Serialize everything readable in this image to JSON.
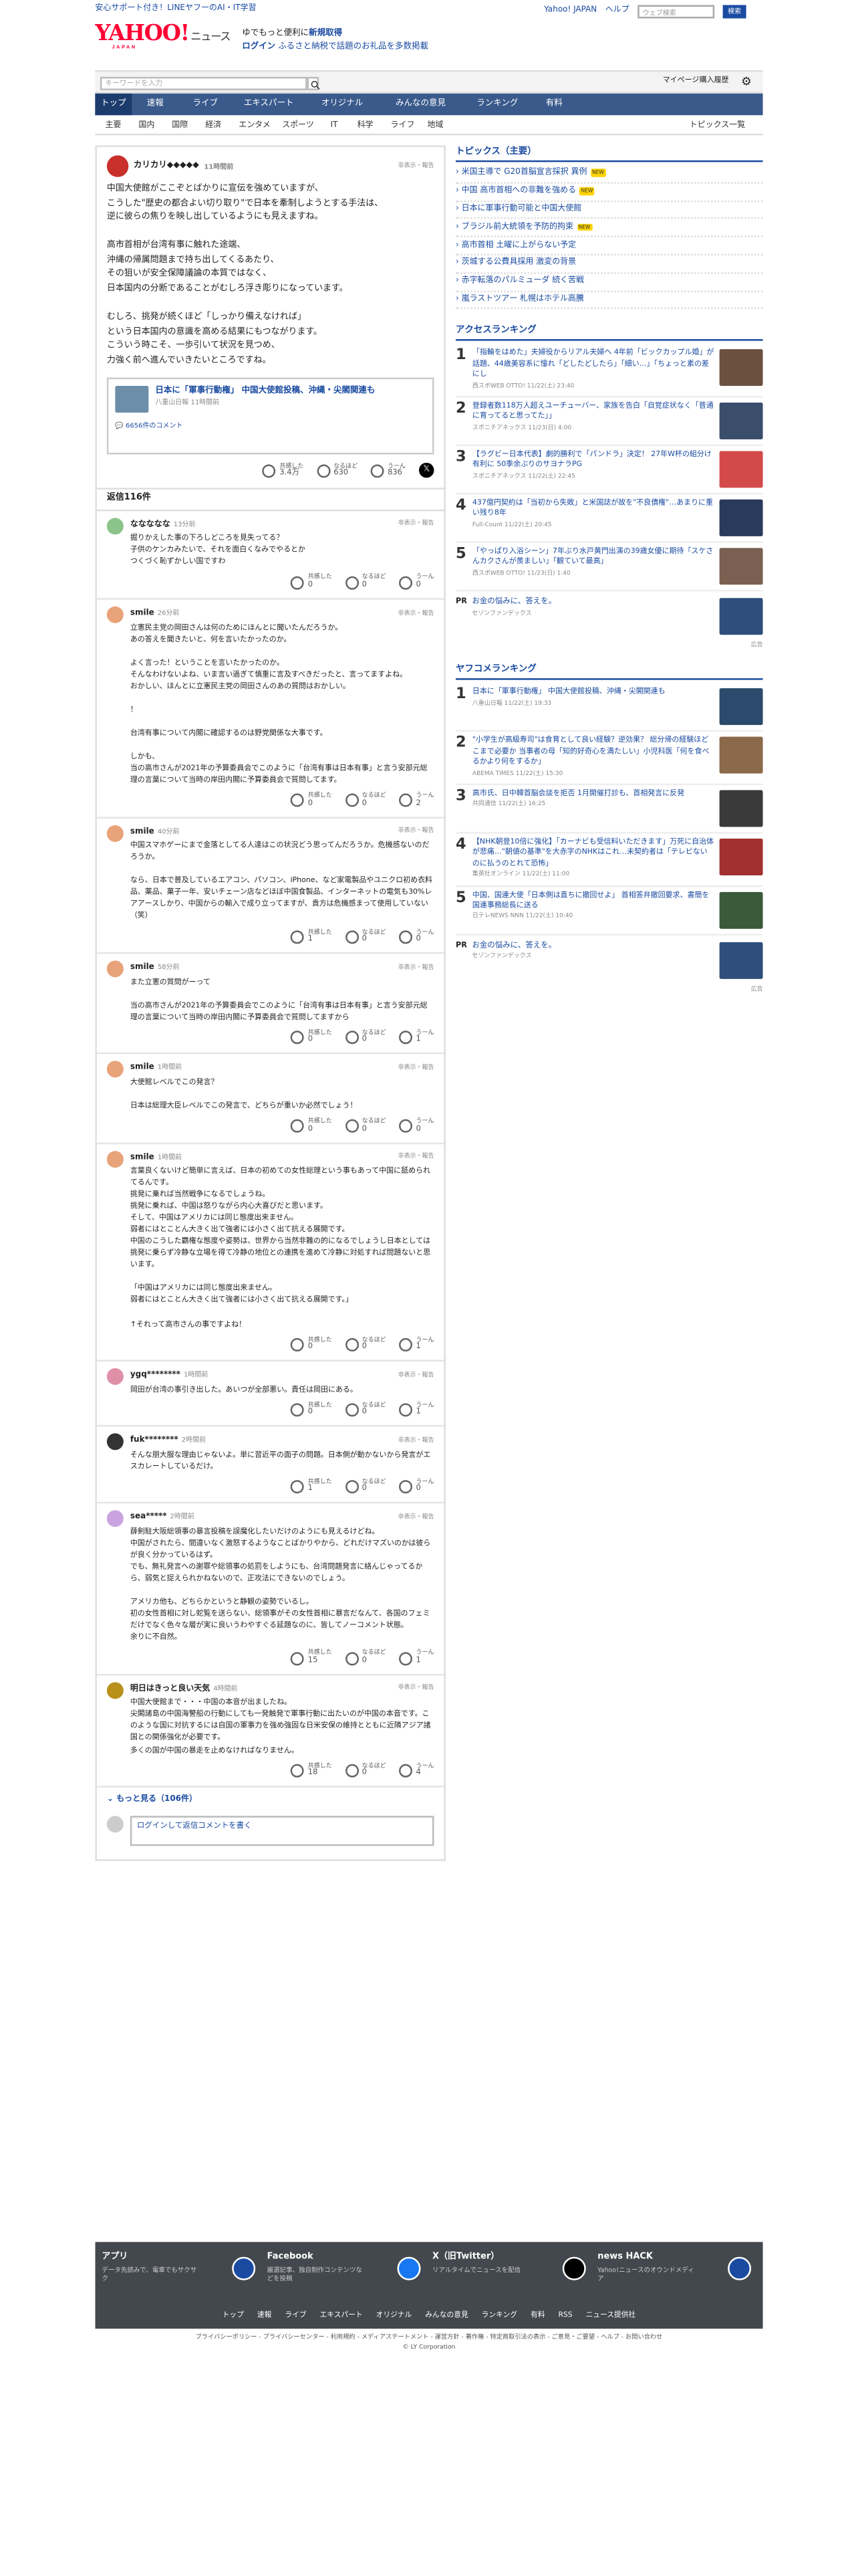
{
  "top_links": [
    "安心サポート付き！LINEヤフーのAI・IT学習"
  ],
  "top_right": {
    "yahoo": "Yahoo! JAPAN",
    "help": "ヘルプ",
    "search_placeholder": "ウェブ検索",
    "search_btn": "検索"
  },
  "logo": {
    "main": "YAHOO!",
    "sub": "ニュース",
    "japan": "JAPAN"
  },
  "promo": {
    "line1": "ゆでもっと便利に",
    "line1b": "新規取得",
    "line2": "ログイン",
    "line2b": "ふるさと納税で話題のお礼品を多数掲載"
  },
  "searchbar": {
    "placeholder": "キーワードを入力",
    "mypage": "マイページ",
    "history": "購入履歴"
  },
  "nav": [
    "トップ",
    "速報",
    "ライブ",
    "エキスパート",
    "オリジナル",
    "みんなの意見",
    "ランキング",
    "有料"
  ],
  "subnav": [
    "主要",
    "国内",
    "国際",
    "経済",
    "エンタメ",
    "スポーツ",
    "IT",
    "科学",
    "ライフ",
    "地域"
  ],
  "subnav_right": "トピックス一覧",
  "comment": {
    "user": "カリカリ◆◆◆◆◆",
    "time": "11時間前",
    "hide": "非表示・報告",
    "body": "中国大使館がここぞとばかりに宣伝を強めていますが、\nこうした\"歴史の都合よい切り取り\"で日本を牽制しようとする手法は、\n逆に彼らの焦りを映し出しているようにも見えますね。\n\n高市首相が台湾有事に触れた途端、\n沖縄の帰属問題まで持ち出してくるあたり、\nその狙いが安全保障議論の本質ではなく、\n日本国内の分断であることがむしろ浮き彫りになっています。\n\nむしろ、挑発が続くほど「しっかり備えなければ」\nという日本国内の意識を高める結果にもつながります。\nこういう時こそ、一歩引いて状況を見つめ、\n力強く前へ進んでいきたいところですね。",
    "article": {
      "title": "日本に「軍事行動権」 中国大使館投稿、沖縄・尖閣関連も",
      "src": "八重山日報",
      "time": "11時間前"
    },
    "article_comments": "6656件のコメント",
    "reactions": {
      "agree": "共感した",
      "agree_n": "3.4万",
      "nod": "なるほど",
      "nod_n": "630",
      "hmm": "うーん",
      "hmm_n": "836"
    }
  },
  "replies_count": "返信116件",
  "replies": [
    {
      "user": "ななななな",
      "time": "13分前",
      "body": "掘りかえした事の下ろしどころを見失ってる？\n子供のケンカみたいで、それを面白くなみでやるとか\nつくづく恥ずかしい国ですわ",
      "a": "0",
      "n": "0",
      "h": "0",
      "color": "#8bc48a"
    },
    {
      "user": "smile",
      "time": "26分前",
      "body": "立憲民主党の岡田さんは何のためにほんとに聞いたんだろうか。\nあの答えを聞きたいと、何を言いたかったのか。\n\nよく言った！ということを言いたかったのか。\nそんなわけないよね、いま言い過ぎて慎重に言及すべきだったと、言ってますよね。\nおかしい、ほんとに立憲民主党の岡田さんのあの質問はおかしい。\n\n！\n\n台湾有事について内閣に確認するのは野党関係な大事です。\n\nしかも、\n当の高市さんが2021年の予算委員会でこのように「台湾有事は日本有事」と言う安部元総理の言葉について当時の岸田内閣に予算委員会で質問してます。",
      "a": "0",
      "n": "0",
      "h": "2",
      "color": "#e8a37a"
    },
    {
      "user": "smile",
      "time": "40分前",
      "body": "中国スマホゲーにまで金落としてる人達はこの状況どう思ってんだろうか。危機感ないのだろうか。\n\nなら、日本で普及しているエアコン、パソコン、iPhone、など家電製品やユニクロ初め衣料品、薬品、菓子一年、安いチェーン店などほぼ中国食製品、インターネットの電気も30%レアアースしかり、中国からの輸入で成り立ってますが、貴方は危機感まって使用していない（笑）",
      "a": "1",
      "n": "0",
      "h": "0",
      "color": "#e8a37a"
    },
    {
      "user": "smile",
      "time": "58分前",
      "body": "また立憲の質問がーって\n\n当の高市さんが2021年の予算委員会でこのように「台湾有事は日本有事」と言う安部元総理の言葉について当時の岸田内閣に予算委員会で質問してますから",
      "a": "0",
      "n": "0",
      "h": "1",
      "color": "#e8a37a"
    },
    {
      "user": "smile",
      "time": "1時間前",
      "body": "大使館レベルでこの発言？\n\n日本は総理大臣レベルでこの発言で、どちらが重いか必然でしょう！",
      "a": "0",
      "n": "0",
      "h": "0",
      "color": "#e8a37a"
    },
    {
      "user": "smile",
      "time": "1時間前",
      "body": "言葉良くないけど簡単に言えば、日本の初めての女性総理という事もあって中国に舐められてるんです。\n挑発に乗れば当然戦争になるでしょうね。\n挑発に乗れば、中国は怒りながら内心大喜びだと思います。\nそして、中国はアメリカには同じ態度出来ません。\n弱者にはとことん大きく出て強者には小さく出て抗える展開です。\n中国のこうした覇権な態度や姿勢は、世界から当然非難の的になるでしょうし日本としては挑発に乗らず冷静な立場を得て冷静の地位との連携を進めて冷静に対処すれば問題ないと思います。\n\n「中国はアメリカには同じ態度出来ません。\n弱者にはとことん大きく出て強者には小さく出て抗える展開です。」\n\n↑それって高市さんの事ですよね！",
      "a": "0",
      "n": "0",
      "h": "1",
      "color": "#e8a37a"
    },
    {
      "user": "ygq********",
      "time": "1時間前",
      "body": "岡田が台湾の事引き出した。あいつが全部悪い。責任は岡田にある。",
      "a": "0",
      "n": "0",
      "h": "1",
      "color": "#e08fa8"
    },
    {
      "user": "fuk********",
      "time": "2時間前",
      "body": "そんな朋大服な理由じゃないよ。単に習近平の面子の問題。日本側が動かないから発言がエスカレートしているだけ。",
      "a": "1",
      "n": "0",
      "h": "0",
      "color": "#333"
    },
    {
      "user": "sea*****",
      "time": "2時間前",
      "body": "薛剣駐大阪総領事の暴言投稿を誤魔化したいだけのようにも見えるけどね。\n中国がされたら、間違いなく激怒するようなことばかりやから、どれだけマズいのかは彼らが良く分かっているはず。\nでも、無礼発言への謝罪や総領事の処罰をしようにも、台湾問題発言に絡んじゃってるから、弱気と捉えられかねないので、正攻法にできないのでしょう。\n\nアメリカ他も、どちらかというと静観の姿勢でいるし。\n初の女性首相に対し蛇覧を送らない、総領事がその女性首相に暴言だなんて、各国のフェミだけでなく色々な層が実に良いうわやすぐる延題なのに、皆してノーコメント状態。\n余りに不自然。",
      "a": "15",
      "n": "0",
      "h": "1",
      "color": "#c9a3e0"
    },
    {
      "user": "明日はきっと良い天気",
      "time": "4時間前",
      "body": "中国大使館まで・・・中国の本音が出ましたね。\n尖閣諸島の中国海警船の行動にしても一発触発で軍事行動に出たいのが中国の本音です。このような国に対抗するには自国の軍事力を強め強固な日米安保の維持とともに近隣アジア諸国との関係強化が必要です。\n多くの国が中国の暴走を止めなければなりません。",
      "a": "18",
      "n": "0",
      "h": "4",
      "color": "#b8901a"
    }
  ],
  "more": "もっと見る（106件）",
  "reply_input": "ログインして返信コメントを書く",
  "side": {
    "topics_title": "トピックス（主要）",
    "topics": [
      {
        "t": "米国主導で G20首脳宣言採択 異例",
        "b": "NEW"
      },
      {
        "t": "中国 高市首相への非難を強める",
        "b": "NEW"
      },
      {
        "t": "日本に軍事行動可能と中国大使館",
        "b": ""
      },
      {
        "t": "ブラジル前大統領を予防的拘束",
        "b": "NEW"
      },
      {
        "t": "高市首相 土曜に上がらない予定",
        "b": ""
      },
      {
        "t": "茨城する公費具採用 激変の背景",
        "b": ""
      },
      {
        "t": "赤字転落のパルミューダ 続く苦戦",
        "b": ""
      },
      {
        "t": "嵐ラストツアー 札幌はホテル高騰",
        "b": ""
      }
    ],
    "access_title": "アクセスランキング",
    "access": [
      {
        "n": "1",
        "t": "「指輪をはめた」夫婦役からリアル夫婦へ 4年前「ビックカップル婚」が話題、44歳美容系に憧れ「どしたどしたら」「細い…」「ちょっと素の差にし",
        "s": "西スポWEB OTTO! 11/22(土) 23:40",
        "c": "#6b5040"
      },
      {
        "n": "2",
        "t": "登録者数118万人超えユーチューバー、家族を告白「自覚症状なく「普通に育ってると思ってた」」",
        "s": "スポニチアネックス 11/23(日) 4:00",
        "c": "#3a4d6b"
      },
      {
        "n": "3",
        "t": "【ラグビー日本代表】劇的勝利で「パンドラ」決定！ 27年W杯の組分け有利に 50季余ぶりのサヨナラPG",
        "s": "スポニチアネックス 11/22(土) 22:45",
        "c": "#d44a4a"
      },
      {
        "n": "4",
        "t": "437億円契約は「当初から失敗」と米国誌が故を\"不良債権\"…あまりに重い残り8年",
        "s": "Full-Count 11/22(土) 20:45",
        "c": "#2a3a5a"
      },
      {
        "n": "5",
        "t": "「やっぱり入浴シーン」7年ぶり水戸黄門出演の39歳女優に期待「スケさんカクさんが羨ましい」「観ていて最高」",
        "s": "西スポWEB OTTO! 11/23(日) 1:40",
        "c": "#7a6050"
      }
    ],
    "pr1": {
      "label": "PR",
      "title": "お金の悩みに、答えを。",
      "src": "セゾンファンデックス",
      "ad": "広告"
    },
    "yahoo_title": "ヤフコメランキング",
    "yahoo": [
      {
        "n": "1",
        "t": "日本に「軍事行動権」 中国大使館投稿、沖縄・尖閣関連も",
        "s": "八重山日報 11/22(土) 19:33",
        "c": "#2c4a6b"
      },
      {
        "n": "2",
        "t": "\"小学生が高級寿司\"は食育として良い経験？逆効果？ 総分帰の経験ほどこまで必要か 当事者の母「知的好奇心を満たしい」小児科医「何を食べるかより何をするか」",
        "s": "ABEMA TIMES 11/22(土) 15:30",
        "c": "#8a6a4a"
      },
      {
        "n": "3",
        "t": "高市氏、日中韓首脳会談を拒否 1月開催打診も、首相発言に反発",
        "s": "共同通信 11/22(土) 16:25",
        "c": "#3a3a3a"
      },
      {
        "n": "4",
        "t": "【NHK朝登10倍に強化】「カーナビも受信料いただきます」万死に自治体が悲痛…\"朝値の基準\"を大赤字のNHKはこれ…未契約者は「テレビないのに払うのとれて恐怖」",
        "s": "集英社オンライン 11/22(土) 11:00",
        "c": "#a23030"
      },
      {
        "n": "5",
        "t": "中国、国連大使「日本側は直ちに撤回せよ」 首相答弁撤回要求、書簡を国連事務総長に送る",
        "s": "日テレNEWS NNN 11/22(土) 10:40",
        "c": "#3a5a3a"
      }
    ],
    "pr2": {
      "label": "PR",
      "title": "お金の悩みに、答えを。",
      "src": "セゾンファンデックス",
      "ad": "広告"
    }
  },
  "footer": {
    "cols": [
      {
        "t": "アプリ",
        "d": "データ先読みで、電車でもサクサク",
        "c": "#1a4ba1"
      },
      {
        "t": "Facebook",
        "d": "厳選記事、独自制作コンテンツなどを投稿",
        "c": "#1877f2"
      },
      {
        "t": "X（旧Twitter）",
        "d": "リアルタイムでニュースを配信",
        "c": "#000"
      },
      {
        "t": "news HACK",
        "d": "Yahoo!ニュースのオウンドメディア",
        "c": "#1a4ba1"
      }
    ],
    "links": [
      "トップ",
      "速報",
      "ライブ",
      "エキスパート",
      "オリジナル",
      "みんなの意見",
      "ランキング",
      "有料",
      "RSS",
      "ニュース提供社"
    ],
    "legal": "プライバシーポリシー - プライバシーセンター - 利用規約 - メディアステートメント - 運営方針 - 著作権 - 特定商取引法の表示 - ご意見・ご要望 - ヘルプ - お問い合わせ",
    "copyright": "© LY Corporation"
  }
}
